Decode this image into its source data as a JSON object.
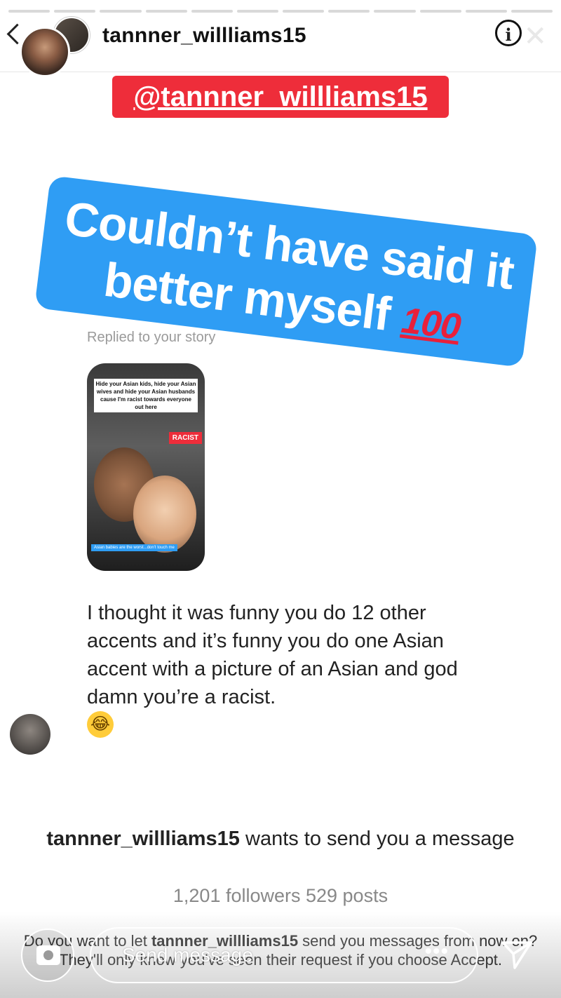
{
  "header": {
    "username": "tannner_willliams15"
  },
  "story": {
    "mention": "@tannner_willliams15",
    "banner_line1": "Couldn’t have said it",
    "banner_line2": "better myself",
    "banner_emoji": "100",
    "replied_label": "Replied to your story",
    "thumbnail": {
      "caption": "Hide your Asian kids, hide your Asian wives and hide your Asian husbands cause I'm racist towards everyone out here",
      "tag": "RACIST",
      "footer": "Asian babies are the worst...don't touch me"
    }
  },
  "message": {
    "text": "I thought it was funny you do 12 other accents and it’s funny you do one Asian accent with a picture of an Asian and god damn you’re a racist.",
    "emoji": "😂"
  },
  "request": {
    "username": "tannner_willliams15",
    "text": " wants to send you a message",
    "stats": "1,201 followers 529 posts",
    "prompt_prefix": "Do you want to let ",
    "prompt_username": "tannner_willliams15",
    "prompt_suffix": " send you messages from now on? They'll only know you've seen their request if you choose Accept."
  },
  "composer": {
    "placeholder": "Send message",
    "more": "•••"
  },
  "colors": {
    "mention_bg": "#ee2d3a",
    "banner_bg": "#2f9df4",
    "emoji_red": "#e8203b"
  },
  "icons": [
    "back-chevron-icon",
    "info-icon",
    "close-icon",
    "camera-icon",
    "send-icon",
    "more-icon"
  ]
}
